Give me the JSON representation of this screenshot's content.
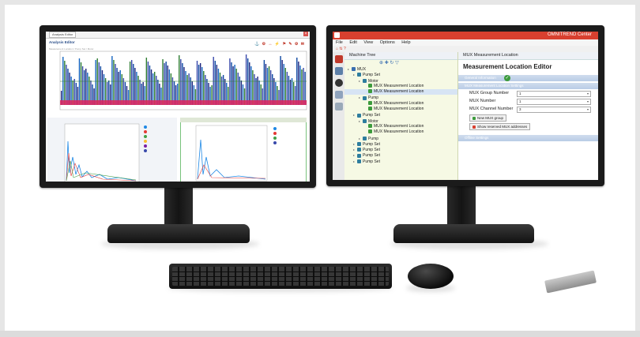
{
  "left_screen": {
    "tab_label": "Analysis Editor",
    "heading": "Analysis Editor",
    "subheading": "Measurement Location / Pump Set / Motor",
    "toolbar_icons": "⚓ ⚙ ↔ ⚡ ⚑ ✎ ⚙ ✉"
  },
  "right_screen": {
    "app_title": "OMNITREND Center",
    "menu": [
      "File",
      "Edit",
      "View",
      "Options",
      "Help"
    ],
    "tree_tab": "Machine Tree",
    "editor_tab": "MUX Measurement Location",
    "editor_title": "Measurement Location Editor",
    "section_general": "General Information",
    "section_mux": "MUX Measurement Location Settings",
    "section_offline": "Offline Settings",
    "fields": [
      {
        "label": "MUX Group Number",
        "value": "1"
      },
      {
        "label": "MUX Number",
        "value": "1"
      },
      {
        "label": "MUX Channel Number",
        "value": "3"
      }
    ],
    "buttons": [
      "New MUX group",
      "Show reserved MUX addresses"
    ],
    "tree": [
      {
        "label": "MUX",
        "level": 0
      },
      {
        "label": "Pump Set",
        "level": 1
      },
      {
        "label": "Motor",
        "level": 2
      },
      {
        "label": "MUX Measurement Location",
        "level": 3
      },
      {
        "label": "MUX Measurement Location",
        "level": 3,
        "selected": true
      },
      {
        "label": "Pump",
        "level": 2
      },
      {
        "label": "MUX Measurement Location",
        "level": 3
      },
      {
        "label": "MUX Measurement Location",
        "level": 3
      },
      {
        "label": "Pump Set",
        "level": 1
      },
      {
        "label": "Motor",
        "level": 2
      },
      {
        "label": "MUX Measurement Location",
        "level": 3
      },
      {
        "label": "MUX Measurement Location",
        "level": 3
      },
      {
        "label": "Pump",
        "level": 2
      },
      {
        "label": "Pump Set",
        "level": 1
      },
      {
        "label": "Pump Set",
        "level": 1
      },
      {
        "label": "Pump Set",
        "level": 1
      },
      {
        "label": "Pump Set",
        "level": 1
      }
    ]
  },
  "colors": {
    "accent_red": "#d8402f",
    "tree_bg": "#f6f9e4",
    "section_blue": "#b9cce6",
    "check_green": "#3c9b3c"
  }
}
